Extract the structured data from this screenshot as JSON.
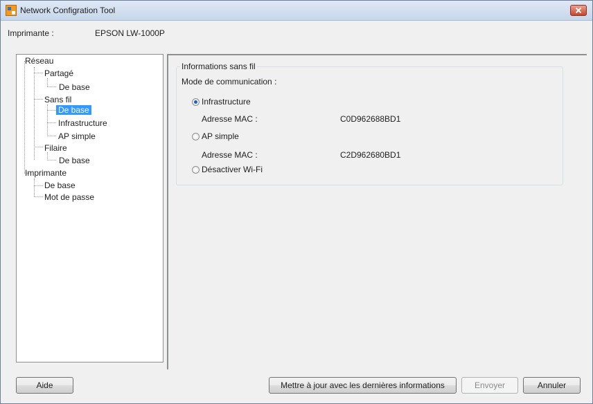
{
  "window": {
    "title": "Network Configration Tool"
  },
  "printer": {
    "label": "Imprimante :",
    "value": "EPSON LW-1000P"
  },
  "tree": {
    "reseau": "Réseau",
    "partage": "Partagé",
    "partage_de_base": "De base",
    "sans_fil": "Sans fil",
    "sans_fil_de_base": "De base",
    "infrastructure": "Infrastructure",
    "ap_simple": "AP simple",
    "filaire": "Filaire",
    "filaire_de_base": "De base",
    "imprimante": "Imprimante",
    "imprimante_de_base": "De base",
    "mot_de_passe": "Mot de passe",
    "selected": "sans_fil_de_base"
  },
  "wireless": {
    "group_title": "Informations sans fil",
    "mode_label": "Mode de communication :",
    "options": [
      {
        "label": "Infrastructure",
        "checked": true
      },
      {
        "label": "AP simple",
        "checked": false
      },
      {
        "label": "Désactiver Wi-Fi",
        "checked": false
      }
    ],
    "mac_label_1": "Adresse MAC :",
    "mac_value_1": "C0D962688BD1",
    "mac_label_2": "Adresse MAC :",
    "mac_value_2": "C2D962680BD1"
  },
  "buttons": {
    "help": "Aide",
    "update": "Mettre à jour avec les dernières informations",
    "send": "Envoyer",
    "cancel": "Annuler"
  },
  "colors": {
    "selection": "#3399ff",
    "titlebar": "#c6d6ea",
    "radio_dot": "#1a61c7"
  }
}
